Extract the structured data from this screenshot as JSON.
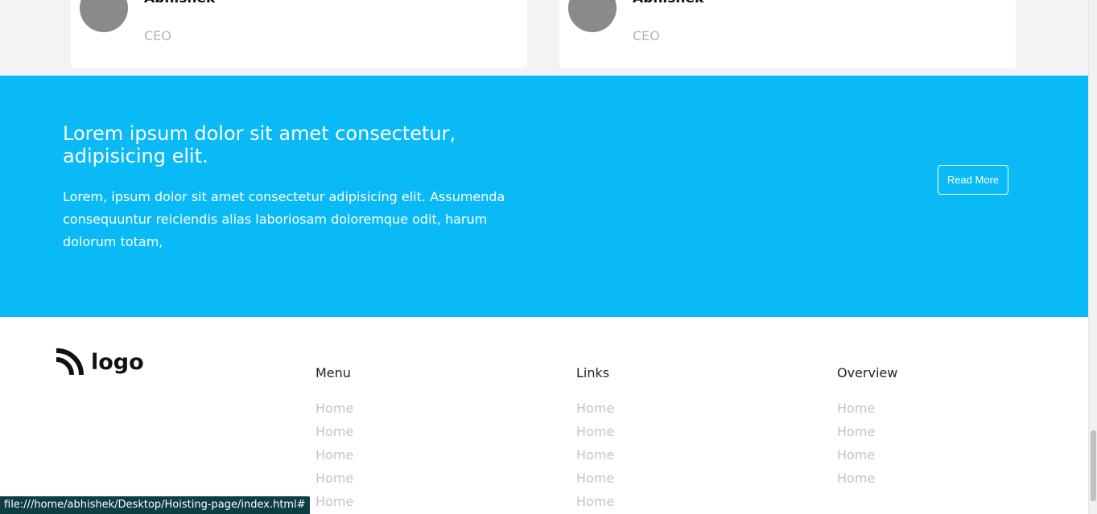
{
  "testimonials": [
    {
      "name": "Abhishek",
      "role": "CEO"
    },
    {
      "name": "Abhishek",
      "role": "CEO"
    }
  ],
  "banner": {
    "title": "Lorem ipsum dolor sit amet consectetur, adipisicing elit.",
    "text": "Lorem, ipsum dolor sit amet consectetur adipisicing elit. Assumenda consequuntur reiciendis alias laboriosam doloremque odit, harum dolorum totam,",
    "button": "Read More",
    "color": "#0abaf6"
  },
  "footer": {
    "logo_text": "logo",
    "columns": [
      {
        "heading": "Menu",
        "items": [
          "Home",
          "Home",
          "Home",
          "Home",
          "Home"
        ]
      },
      {
        "heading": "Links",
        "items": [
          "Home",
          "Home",
          "Home",
          "Home",
          "Home"
        ]
      },
      {
        "heading": "Overview",
        "items": [
          "Home",
          "Home",
          "Home",
          "Home"
        ]
      }
    ]
  },
  "status_bar": {
    "url": "file:///home/abhishek/Desktop/Hoisting-page/index.html#"
  }
}
